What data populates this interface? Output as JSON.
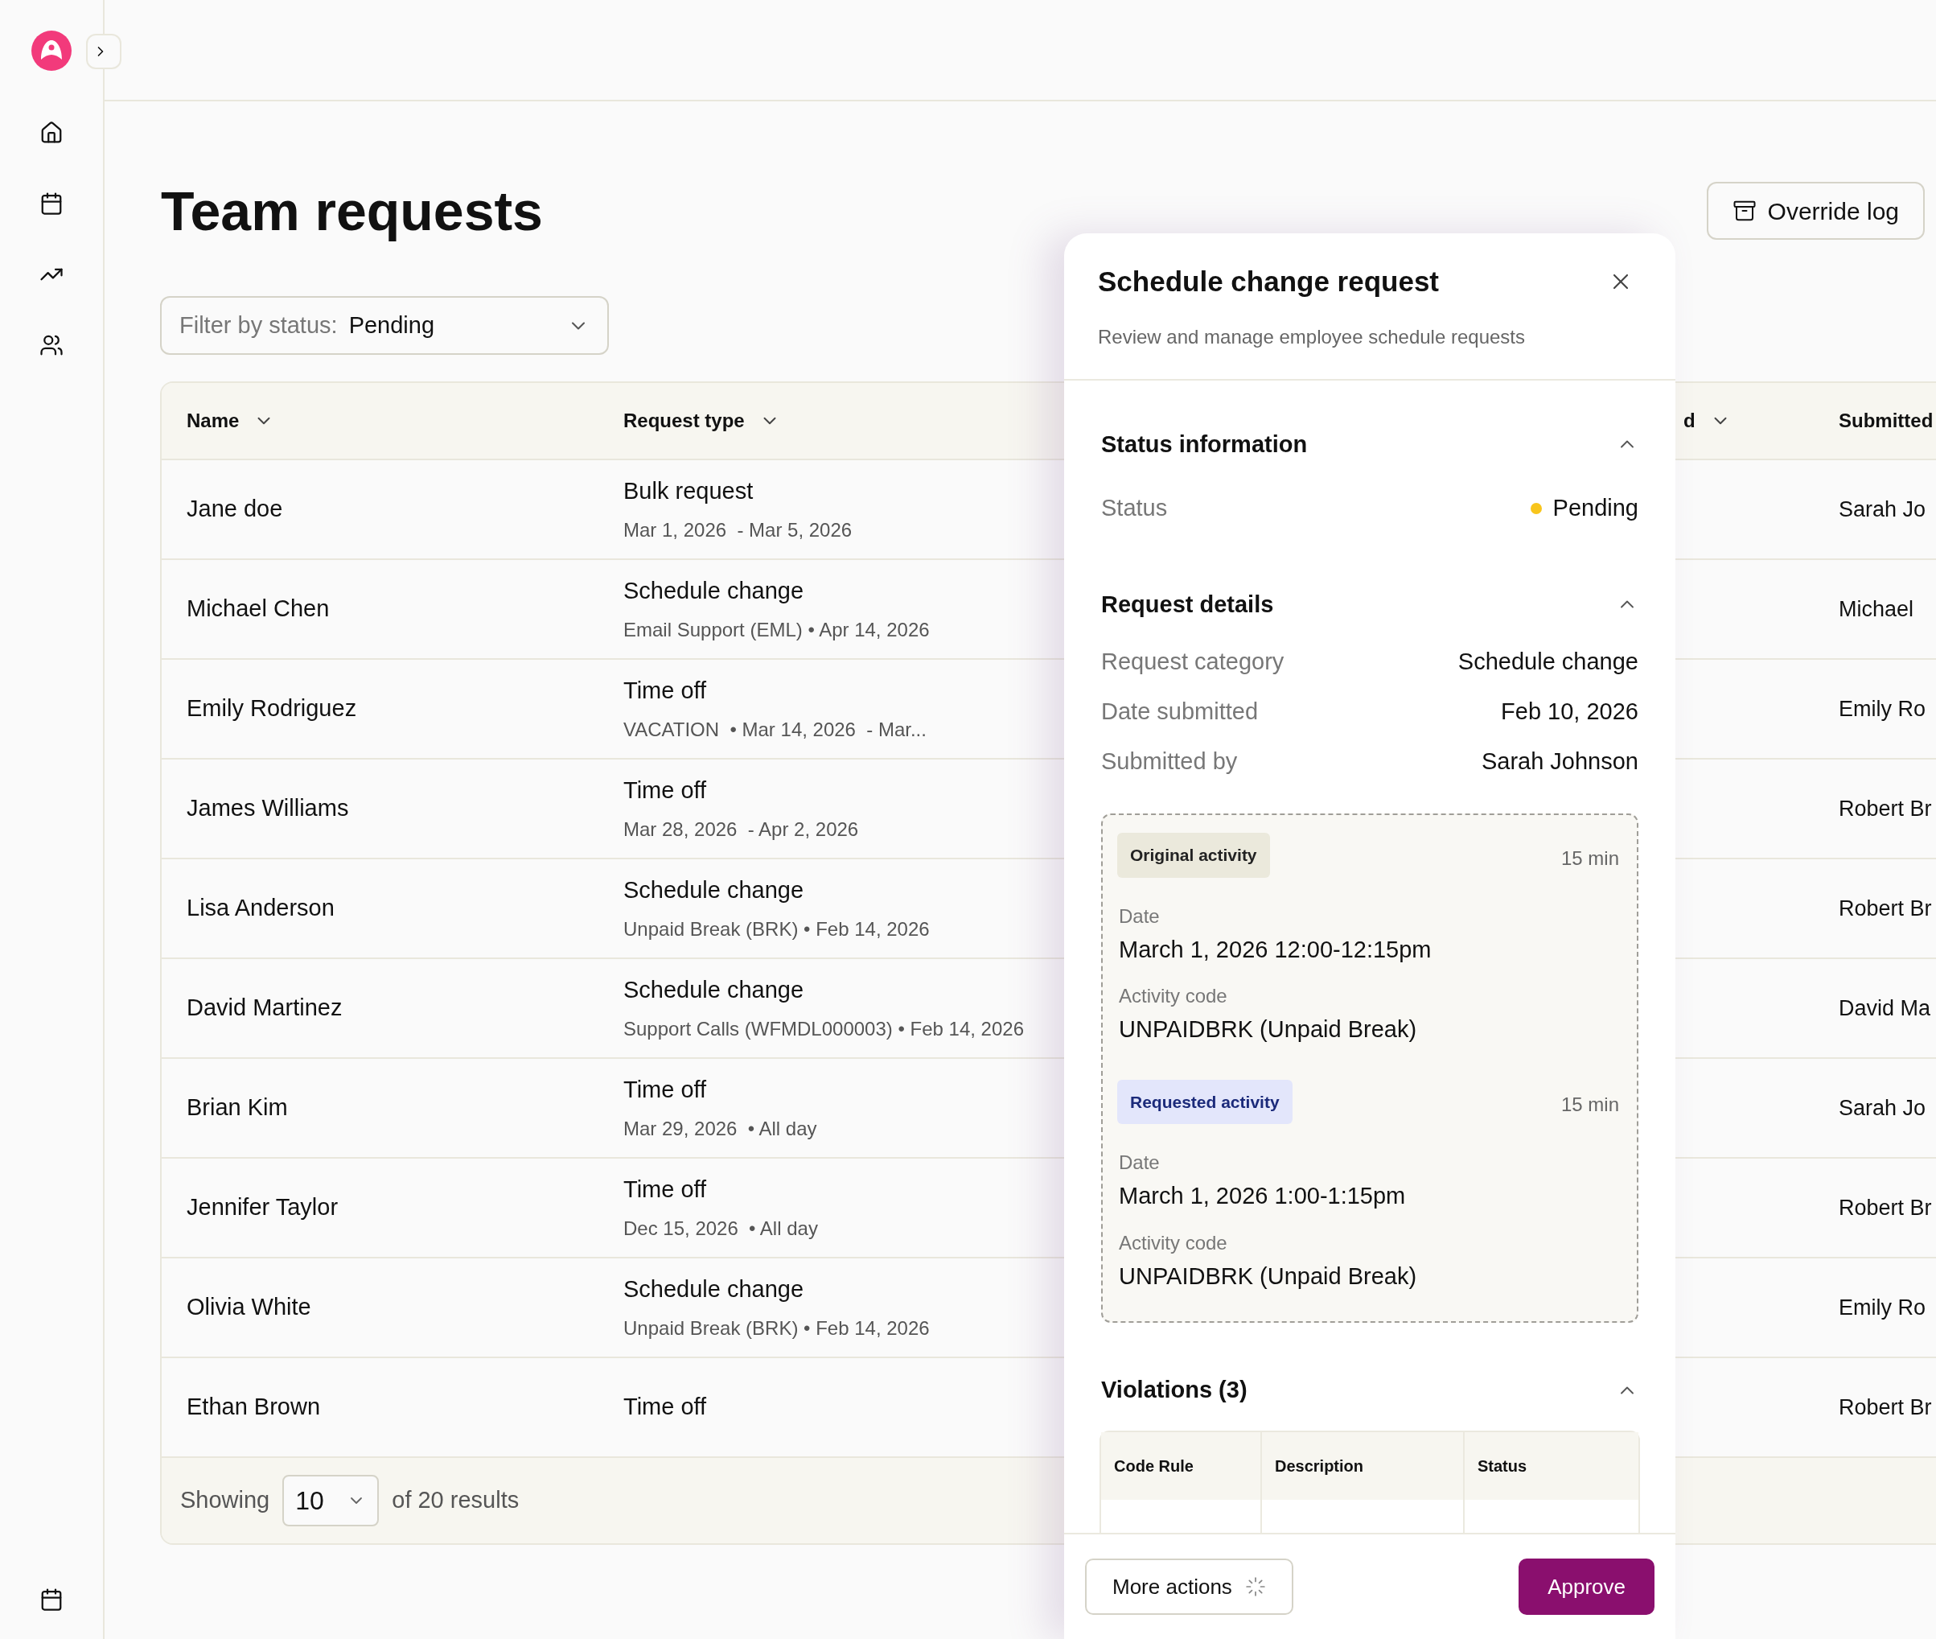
{
  "page": {
    "title": "Team requests",
    "override_button": "Override log"
  },
  "filter": {
    "label": "Filter by status:",
    "value": "Pending"
  },
  "table": {
    "columns": [
      {
        "label": "Name",
        "sortable": true
      },
      {
        "label": "Request type",
        "sortable": true
      },
      {
        "label": "d",
        "sortable": true
      },
      {
        "label": "Submitted",
        "sortable": false
      }
    ],
    "rows": [
      {
        "name": "Jane doe",
        "type": "Bulk request",
        "detail": "Mar 1, 2026  - Mar 5, 2026",
        "submitted": "Sarah Jo"
      },
      {
        "name": "Michael Chen",
        "type": "Schedule change",
        "detail": "Email Support (EML) • Apr 14, 2026",
        "submitted": "Michael"
      },
      {
        "name": "Emily Rodriguez",
        "type": "Time off",
        "detail": "VACATION  • Mar 14, 2026  - Mar...",
        "submitted": "Emily Ro"
      },
      {
        "name": "James Williams",
        "type": "Time off",
        "detail": "Mar 28, 2026  - Apr 2, 2026",
        "submitted": "Robert Br"
      },
      {
        "name": "Lisa Anderson",
        "type": "Schedule change",
        "detail": "Unpaid Break (BRK) • Feb 14, 2026",
        "submitted": "Robert Br"
      },
      {
        "name": "David Martinez",
        "type": "Schedule change",
        "detail": "Support Calls (WFMDL000003) • Feb 14, 2026",
        "submitted": "David Ma"
      },
      {
        "name": "Brian Kim",
        "type": "Time off",
        "detail": "Mar 29, 2026  • All day",
        "submitted": "Sarah Jo"
      },
      {
        "name": "Jennifer Taylor",
        "type": "Time off",
        "detail": "Dec 15, 2026  • All day",
        "submitted": "Robert Br"
      },
      {
        "name": "Olivia White",
        "type": "Schedule change",
        "detail": "Unpaid Break (BRK) • Feb 14, 2026",
        "submitted": "Emily Ro"
      },
      {
        "name": "Ethan Brown",
        "type": "Time off",
        "submitted": "Robert Br"
      }
    ],
    "footer": {
      "showing": "Showing",
      "page_size": "10",
      "total": "of 20 results"
    }
  },
  "panel": {
    "title": "Schedule change request",
    "subtitle": "Review and manage employee schedule requests",
    "status_section": {
      "title": "Status information",
      "expanded": true,
      "rows": [
        {
          "label": "Status",
          "value": "Pending",
          "color": "#f8c51c"
        }
      ]
    },
    "details_section": {
      "title": "Request details",
      "expanded": true,
      "rows": [
        {
          "label": "Request category",
          "value": "Schedule change"
        },
        {
          "label": "Date submitted",
          "value": "Feb 10, 2026"
        },
        {
          "label": "Submitted by",
          "value": "Sarah Johnson"
        }
      ]
    },
    "activities": [
      {
        "kind": "original",
        "badge": "Original activity",
        "duration": "15 min",
        "fields": [
          {
            "label": "Date",
            "value": "March 1, 2026 12:00-12:15pm"
          },
          {
            "label": "Activity code",
            "value": "UNPAIDBRK (Unpaid Break)"
          }
        ]
      },
      {
        "kind": "requested",
        "badge": "Requested activity",
        "duration": "15 min",
        "fields": [
          {
            "label": "Date",
            "value": "March 1, 2026 1:00-1:15pm"
          },
          {
            "label": "Activity code",
            "value": "UNPAIDBRK (Unpaid Break)"
          }
        ]
      }
    ],
    "violations": {
      "title": "Violations (3)",
      "expanded": true,
      "columns": [
        "Code Rule",
        "Description",
        "Status"
      ]
    },
    "buttons": {
      "more": "More actions",
      "approve": "Approve"
    }
  }
}
